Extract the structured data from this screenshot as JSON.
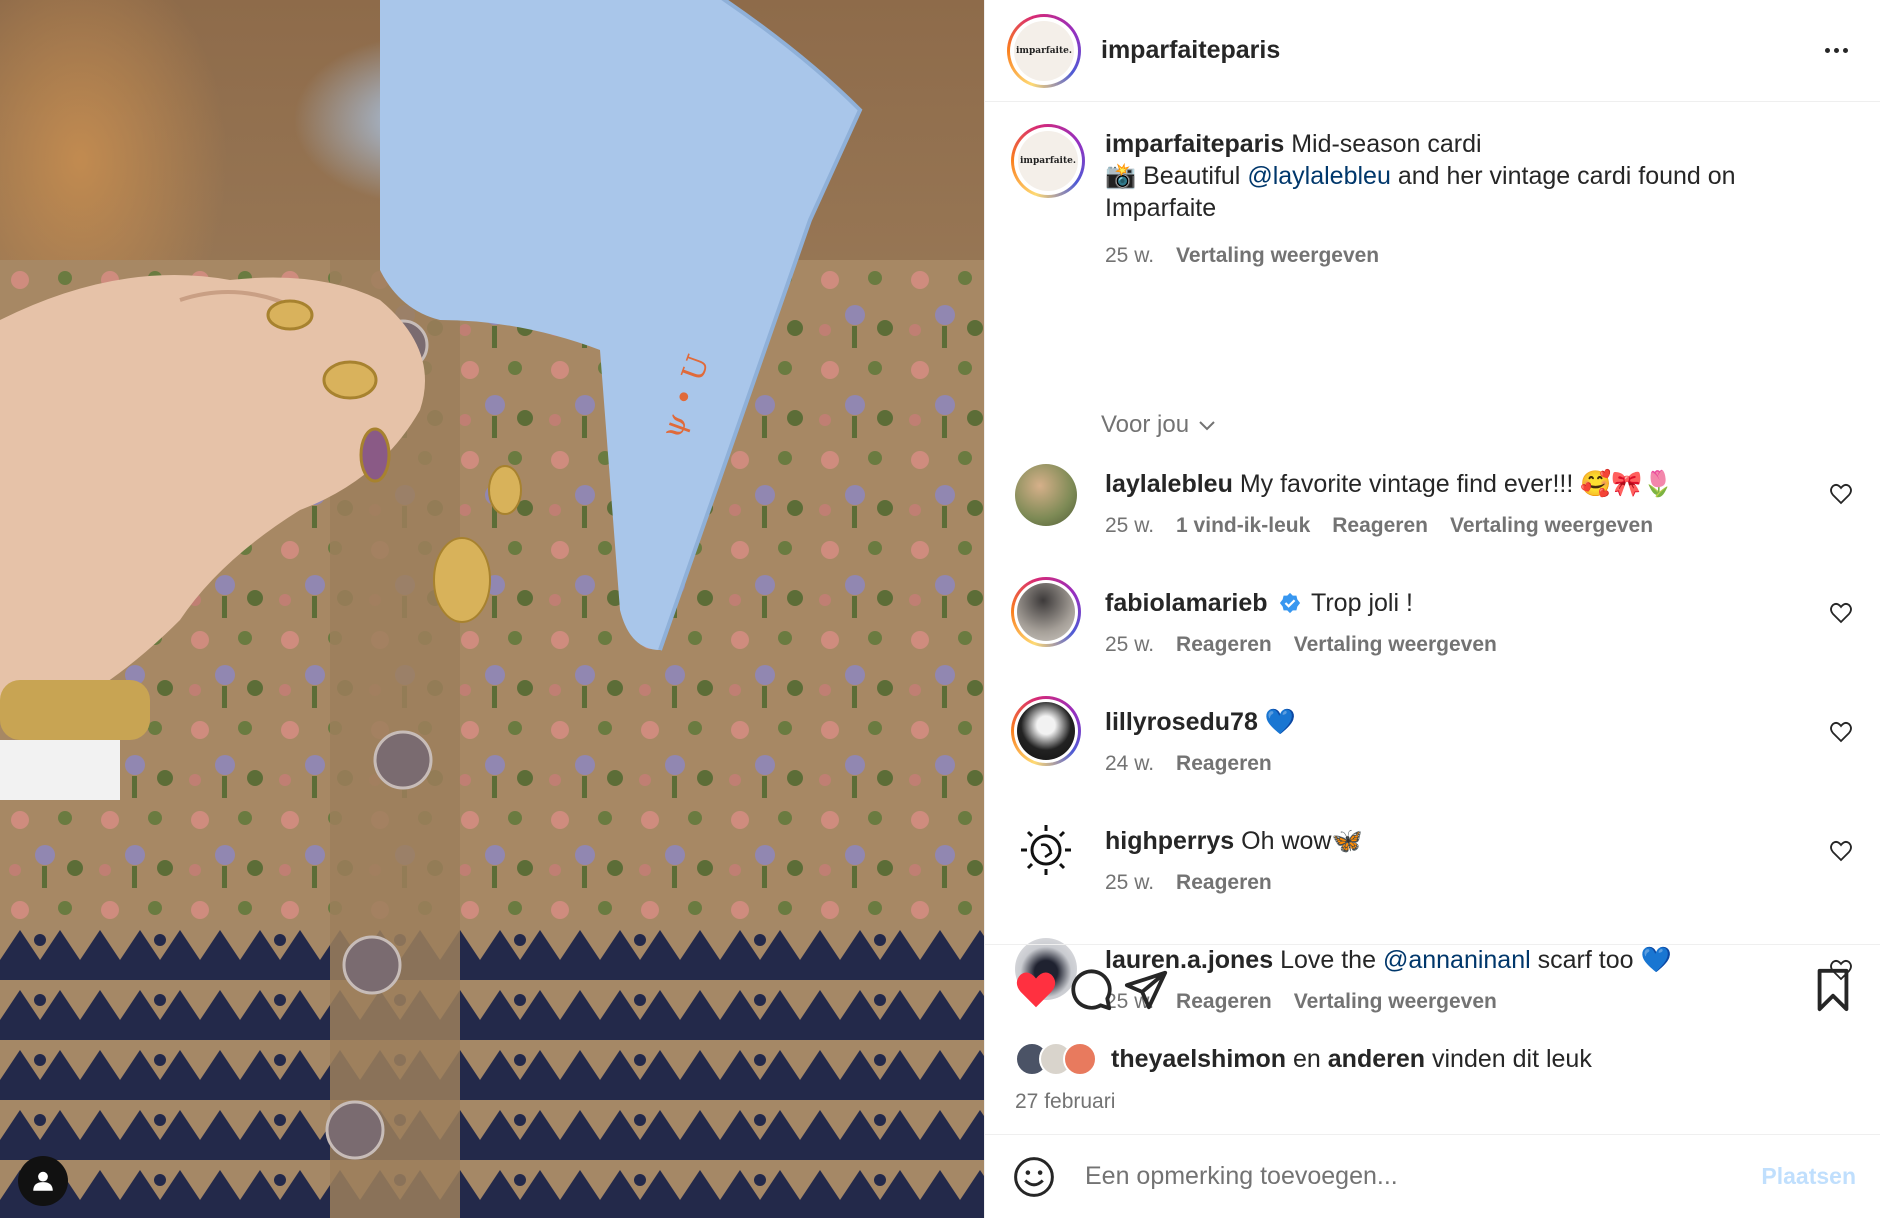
{
  "post": {
    "username": "imparfaiteparis",
    "brand_logo_text": "imparfaite.",
    "caption": {
      "username": "imparfaiteparis",
      "line1": "Mid-season cardi",
      "line2_prefix": "📸 Beautiful",
      "mention": "@laylalebleu",
      "line2_suffix": "and her vintage cardi found on",
      "line3": "Imparfaite",
      "age": "25 w.",
      "translate": "Vertaling weergeven"
    },
    "section_label": "Voor jou"
  },
  "comments": [
    {
      "username": "laylalebleu",
      "text": "My favorite vintage find ever!!! 🥰🎀🌷",
      "age": "25 w.",
      "likes": "1 vind-ik-leuk",
      "reply": "Reageren",
      "translate": "Vertaling weergeven"
    },
    {
      "username": "fabiolamarieb",
      "verified": true,
      "text": "Trop joli !",
      "age": "25 w.",
      "reply": "Reageren",
      "translate": "Vertaling weergeven"
    },
    {
      "username": "lillyrosedu78",
      "text": "💙",
      "age": "24 w.",
      "reply": "Reageren"
    },
    {
      "username": "highperrys",
      "text": "Oh wow🦋",
      "age": "25 w.",
      "reply": "Reageren"
    },
    {
      "username": "lauren.a.jones",
      "text_prefix": "Love the",
      "mention": "@annaninanl",
      "text_suffix": "scarf too 💙",
      "age": "25 w.",
      "reply": "Reageren",
      "translate": "Vertaling weergeven"
    }
  ],
  "likes": {
    "user": "theyaelshimon",
    "middle": "en",
    "others": "anderen",
    "suffix": "vinden dit leuk",
    "date": "27 februari"
  },
  "add_comment": {
    "placeholder": "Een opmerking toevoegen...",
    "post_label": "Plaatsen"
  },
  "colors": {
    "like_red": "#ff3040",
    "link_blue": "#00376b",
    "muted": "#737373",
    "post_disabled": "#c0dffd"
  }
}
